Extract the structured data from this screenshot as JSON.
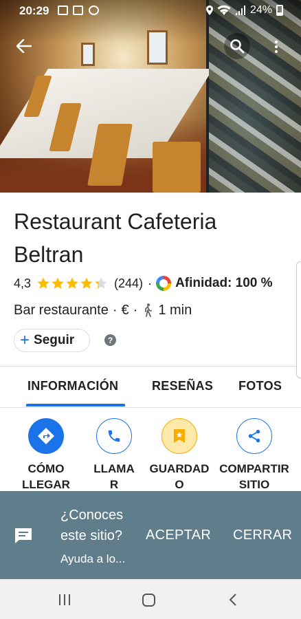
{
  "status_bar": {
    "time": "20:29",
    "battery": "24%"
  },
  "place": {
    "name": "Restaurant Cafeteria Beltran",
    "rating": "4,3",
    "stars": 4.3,
    "reviews_count": "(244)",
    "affinity": "Afinidad: 100 %",
    "category": "Bar restaurante",
    "price": "€",
    "walk_time": "1 min",
    "separator": "·"
  },
  "follow": {
    "plus": "+",
    "label": "Seguir",
    "help": "?"
  },
  "tabs": [
    {
      "label": "INFORMACIÓN",
      "active": true
    },
    {
      "label": "RESEÑAS",
      "active": false
    },
    {
      "label": "FOTOS",
      "active": false
    }
  ],
  "actions": [
    {
      "line1": "CÓMO",
      "line2": "LLEGAR",
      "icon": "directions-icon"
    },
    {
      "line1": "LLAMA",
      "line2": "R",
      "icon": "phone-icon"
    },
    {
      "line1": "GUARDAD",
      "line2": "O",
      "icon": "bookmark-icon"
    },
    {
      "line1": "COMPARTIR",
      "line2": "SITIO",
      "icon": "share-icon"
    }
  ],
  "banner": {
    "question_line1": "¿Conoces",
    "question_line2": "este sitio?",
    "subtitle": "Ayuda a lo...",
    "accept": "ACEPTAR",
    "close": "CERRAR"
  },
  "colors": {
    "accent": "#1a73e8",
    "banner_bg": "#5f7d8a",
    "star": "#fbbc04",
    "saved_bg": "#fde9a9"
  }
}
